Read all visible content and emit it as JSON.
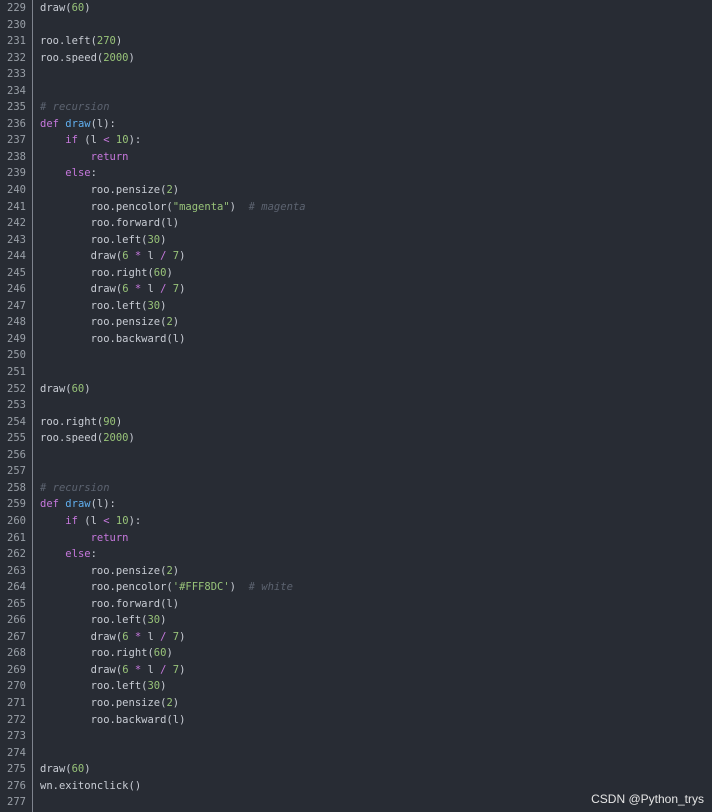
{
  "gutter": {
    "line_numbers": [
      "229",
      "230",
      "231",
      "232",
      "233",
      "234",
      "235",
      "236",
      "237",
      "238",
      "239",
      "240",
      "241",
      "242",
      "243",
      "244",
      "245",
      "246",
      "247",
      "248",
      "249",
      "250",
      "251",
      "252",
      "253",
      "254",
      "255",
      "256",
      "257",
      "258",
      "259",
      "260",
      "261",
      "262",
      "263",
      "264",
      "265",
      "266",
      "267",
      "268",
      "269",
      "270",
      "271",
      "272",
      "273",
      "274",
      "275",
      "276",
      "277"
    ]
  },
  "code": {
    "lines": [
      [
        [
          "t",
          "draw("
        ],
        [
          "num",
          "60"
        ],
        [
          "t",
          ")"
        ]
      ],
      [],
      [
        [
          "t",
          "roo.left("
        ],
        [
          "num",
          "270"
        ],
        [
          "t",
          ")"
        ]
      ],
      [
        [
          "t",
          "roo.speed("
        ],
        [
          "num",
          "2000"
        ],
        [
          "t",
          ")"
        ]
      ],
      [],
      [],
      [
        [
          "cm",
          "# recursion"
        ]
      ],
      [
        [
          "kw",
          "def "
        ],
        [
          "fn",
          "draw"
        ],
        [
          "t",
          "(l):"
        ]
      ],
      [
        [
          "t",
          "    "
        ],
        [
          "kw",
          "if"
        ],
        [
          "t",
          " (l "
        ],
        [
          "op",
          "<"
        ],
        [
          "t",
          " "
        ],
        [
          "num",
          "10"
        ],
        [
          "t",
          "):"
        ]
      ],
      [
        [
          "t",
          "        "
        ],
        [
          "kw",
          "return"
        ]
      ],
      [
        [
          "t",
          "    "
        ],
        [
          "kw",
          "else"
        ],
        [
          "t",
          ":"
        ]
      ],
      [
        [
          "t",
          "        roo.pensize("
        ],
        [
          "num",
          "2"
        ],
        [
          "t",
          ")"
        ]
      ],
      [
        [
          "t",
          "        roo.pencolor("
        ],
        [
          "str",
          "\"magenta\""
        ],
        [
          "t",
          ")  "
        ],
        [
          "cm",
          "# magenta"
        ]
      ],
      [
        [
          "t",
          "        roo.forward(l)"
        ]
      ],
      [
        [
          "t",
          "        roo.left("
        ],
        [
          "num",
          "30"
        ],
        [
          "t",
          ")"
        ]
      ],
      [
        [
          "t",
          "        draw("
        ],
        [
          "num",
          "6"
        ],
        [
          "t",
          " "
        ],
        [
          "op",
          "*"
        ],
        [
          "t",
          " l "
        ],
        [
          "op",
          "/"
        ],
        [
          "t",
          " "
        ],
        [
          "num",
          "7"
        ],
        [
          "t",
          ")"
        ]
      ],
      [
        [
          "t",
          "        roo.right("
        ],
        [
          "num",
          "60"
        ],
        [
          "t",
          ")"
        ]
      ],
      [
        [
          "t",
          "        draw("
        ],
        [
          "num",
          "6"
        ],
        [
          "t",
          " "
        ],
        [
          "op",
          "*"
        ],
        [
          "t",
          " l "
        ],
        [
          "op",
          "/"
        ],
        [
          "t",
          " "
        ],
        [
          "num",
          "7"
        ],
        [
          "t",
          ")"
        ]
      ],
      [
        [
          "t",
          "        roo.left("
        ],
        [
          "num",
          "30"
        ],
        [
          "t",
          ")"
        ]
      ],
      [
        [
          "t",
          "        roo.pensize("
        ],
        [
          "num",
          "2"
        ],
        [
          "t",
          ")"
        ]
      ],
      [
        [
          "t",
          "        roo.backward(l)"
        ]
      ],
      [],
      [],
      [
        [
          "t",
          "draw("
        ],
        [
          "num",
          "60"
        ],
        [
          "t",
          ")"
        ]
      ],
      [],
      [
        [
          "t",
          "roo.right("
        ],
        [
          "num",
          "90"
        ],
        [
          "t",
          ")"
        ]
      ],
      [
        [
          "t",
          "roo.speed("
        ],
        [
          "num",
          "2000"
        ],
        [
          "t",
          ")"
        ]
      ],
      [],
      [],
      [
        [
          "cm",
          "# recursion"
        ]
      ],
      [
        [
          "kw",
          "def "
        ],
        [
          "fn",
          "draw"
        ],
        [
          "t",
          "(l):"
        ]
      ],
      [
        [
          "t",
          "    "
        ],
        [
          "kw",
          "if"
        ],
        [
          "t",
          " (l "
        ],
        [
          "op",
          "<"
        ],
        [
          "t",
          " "
        ],
        [
          "num",
          "10"
        ],
        [
          "t",
          "):"
        ]
      ],
      [
        [
          "t",
          "        "
        ],
        [
          "kw",
          "return"
        ]
      ],
      [
        [
          "t",
          "    "
        ],
        [
          "kw",
          "else"
        ],
        [
          "t",
          ":"
        ]
      ],
      [
        [
          "t",
          "        roo.pensize("
        ],
        [
          "num",
          "2"
        ],
        [
          "t",
          ")"
        ]
      ],
      [
        [
          "t",
          "        roo.pencolor("
        ],
        [
          "str",
          "'#FFF8DC'"
        ],
        [
          "t",
          ")  "
        ],
        [
          "cm",
          "# white"
        ]
      ],
      [
        [
          "t",
          "        roo.forward(l)"
        ]
      ],
      [
        [
          "t",
          "        roo.left("
        ],
        [
          "num",
          "30"
        ],
        [
          "t",
          ")"
        ]
      ],
      [
        [
          "t",
          "        draw("
        ],
        [
          "num",
          "6"
        ],
        [
          "t",
          " "
        ],
        [
          "op",
          "*"
        ],
        [
          "t",
          " l "
        ],
        [
          "op",
          "/"
        ],
        [
          "t",
          " "
        ],
        [
          "num",
          "7"
        ],
        [
          "t",
          ")"
        ]
      ],
      [
        [
          "t",
          "        roo.right("
        ],
        [
          "num",
          "60"
        ],
        [
          "t",
          ")"
        ]
      ],
      [
        [
          "t",
          "        draw("
        ],
        [
          "num",
          "6"
        ],
        [
          "t",
          " "
        ],
        [
          "op",
          "*"
        ],
        [
          "t",
          " l "
        ],
        [
          "op",
          "/"
        ],
        [
          "t",
          " "
        ],
        [
          "num",
          "7"
        ],
        [
          "t",
          ")"
        ]
      ],
      [
        [
          "t",
          "        roo.left("
        ],
        [
          "num",
          "30"
        ],
        [
          "t",
          ")"
        ]
      ],
      [
        [
          "t",
          "        roo.pensize("
        ],
        [
          "num",
          "2"
        ],
        [
          "t",
          ")"
        ]
      ],
      [
        [
          "t",
          "        roo.backward(l)"
        ]
      ],
      [],
      [],
      [
        [
          "t",
          "draw("
        ],
        [
          "num",
          "60"
        ],
        [
          "t",
          ")"
        ]
      ],
      [
        [
          "t",
          "wn.exitonclick()"
        ]
      ],
      []
    ]
  },
  "watermark": {
    "text": "CSDN @Python_trys"
  },
  "colors": {
    "background": "#282c34",
    "keyword": "#c678dd",
    "function": "#61afef",
    "number": "#98c379",
    "comment": "#5c6370",
    "text": "#c8ccd4"
  }
}
